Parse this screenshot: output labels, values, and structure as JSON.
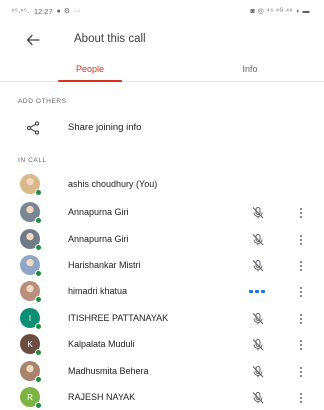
{
  "status_bar": {
    "left_signal": "ⁿ⁵.ⁿ⁵.",
    "time": "12:27",
    "left_icons": "● ⚙ ···",
    "right_icons": "◙ ◎ ⁴⁶ ⁴ᴳ ⁴⁶ ◖ ▬"
  },
  "app_bar": {
    "title": "About this call",
    "back_icon": "arrow-left"
  },
  "tabs": [
    {
      "label": "People",
      "selected": true
    },
    {
      "label": "Info",
      "selected": false
    }
  ],
  "sections": {
    "add_others": "ADD OTHERS",
    "in_call": "IN CALL"
  },
  "share": {
    "label": "Share joining info",
    "icon": "share-icon"
  },
  "participants": [
    {
      "name": "ashis choudhury (You)",
      "avatar": "photo",
      "avatar_color": "#d7b98a",
      "initial": "",
      "mic": "none"
    },
    {
      "name": "Annapurna Giri",
      "avatar": "photo",
      "avatar_color": "#7a8694",
      "initial": "",
      "mic": "muted"
    },
    {
      "name": "Annapurna Giri",
      "avatar": "photo",
      "avatar_color": "#6f7b88",
      "initial": "",
      "mic": "muted"
    },
    {
      "name": "Harishankar Mistri",
      "avatar": "photo",
      "avatar_color": "#8fa7c7",
      "initial": "",
      "mic": "muted"
    },
    {
      "name": "himadri khatua",
      "avatar": "photo",
      "avatar_color": "#b88f7c",
      "initial": "",
      "mic": "speaking"
    },
    {
      "name": "ITISHREE PATTANAYAK",
      "avatar": "initial",
      "avatar_color": "#0b8f74",
      "initial": "I",
      "mic": "muted"
    },
    {
      "name": "Kalpalata Muduli",
      "avatar": "initial",
      "avatar_color": "#6d4c41",
      "initial": "K",
      "mic": "muted"
    },
    {
      "name": "Madhusmita Behera",
      "avatar": "photo",
      "avatar_color": "#a9836b",
      "initial": "",
      "mic": "muted"
    },
    {
      "name": "RAJESH NAYAK",
      "avatar": "initial",
      "avatar_color": "#7cb342",
      "initial": "R",
      "mic": "muted"
    }
  ],
  "colors": {
    "accent": "#d93025",
    "presence": "#1e8e3e",
    "speaking": "#1a73e8",
    "text_secondary": "#5f6368"
  }
}
